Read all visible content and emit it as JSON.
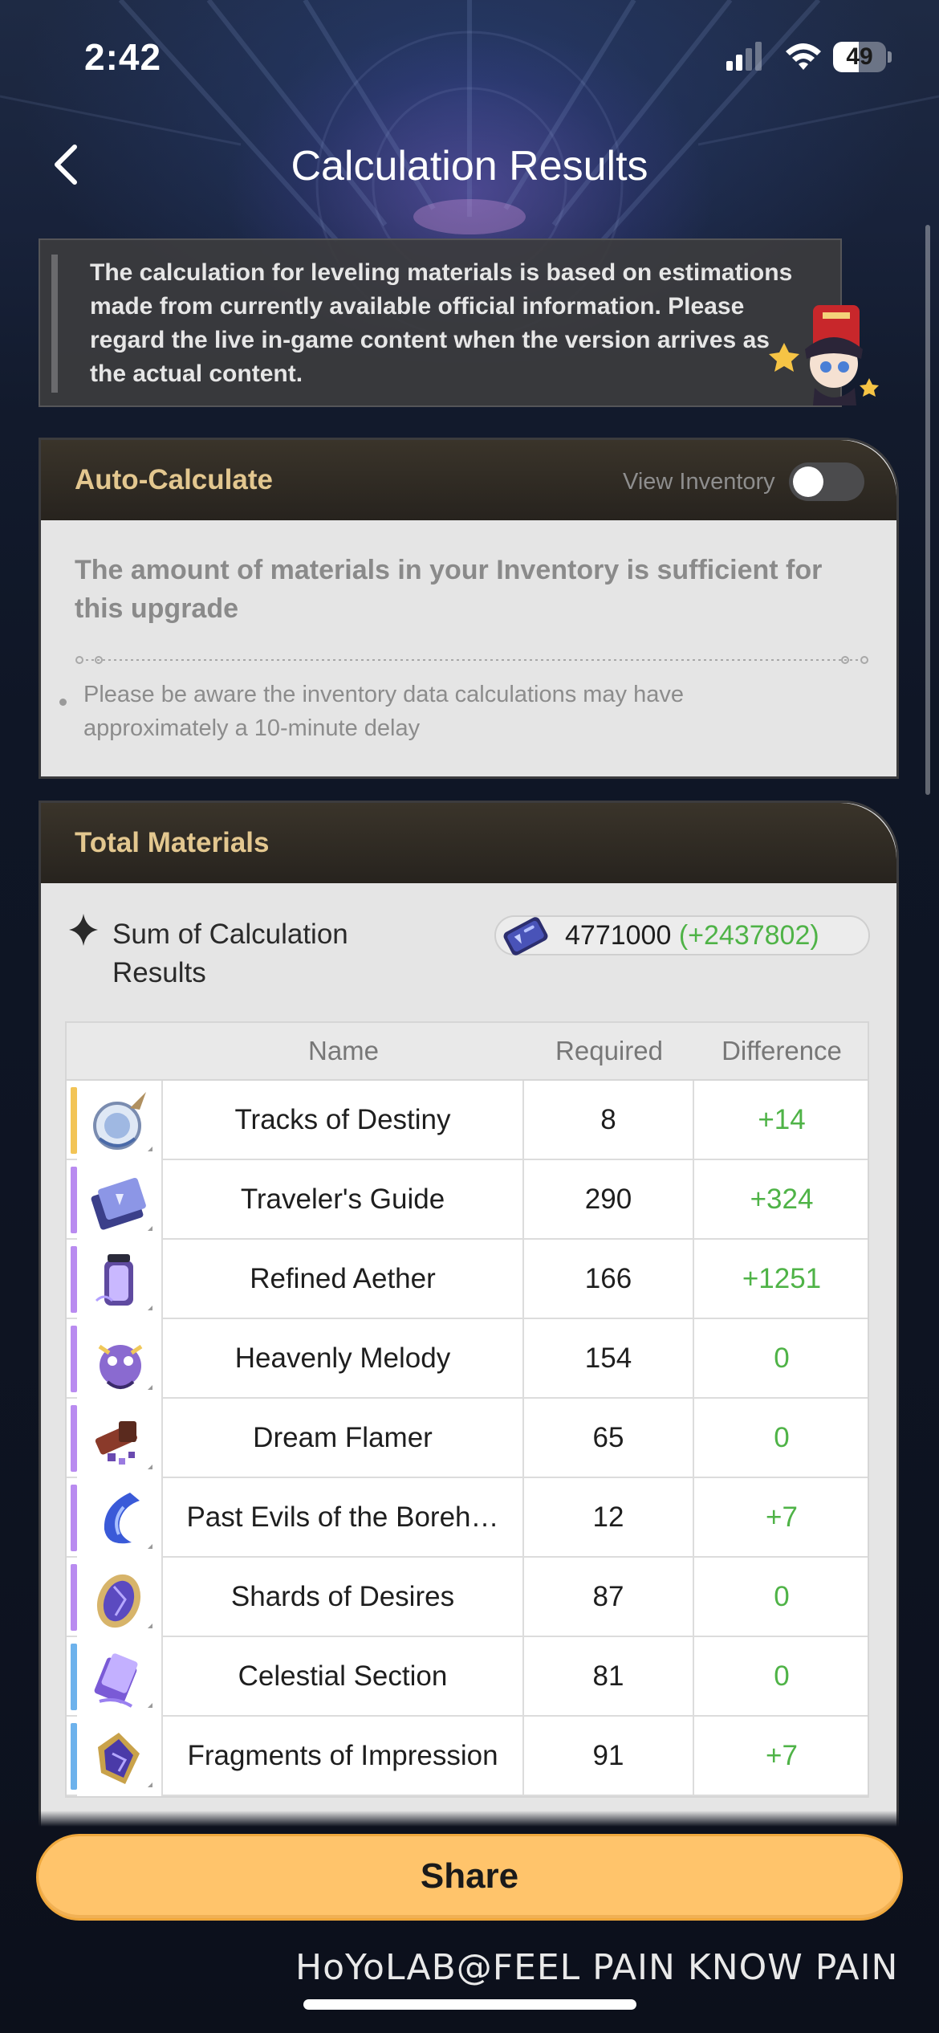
{
  "status_bar": {
    "time": "2:42",
    "battery": "49",
    "battery_level": 0.49
  },
  "header": {
    "title": "Calculation Results"
  },
  "notice": {
    "text": "The calculation for leveling materials is based on estimations made from currently available official information. Please regard the live in-game content when the version arrives as the actual content."
  },
  "auto_calculate": {
    "title": "Auto-Calculate",
    "inventory_toggle_label": "View Inventory",
    "inventory_toggle_on": false,
    "message": "The amount of materials in your Inventory is sufficient for this upgrade",
    "note": "Please be aware the inventory data calculations may have approximately a 10-minute delay"
  },
  "total_materials": {
    "title": "Total Materials",
    "sum_label": "Sum of Calculation Results",
    "sum_value": "4771000",
    "sum_diff": "(+2437802)",
    "columns": {
      "name": "Name",
      "required": "Required",
      "difference": "Difference"
    },
    "rows": [
      {
        "name": "Tracks of Destiny",
        "required": "8",
        "difference": "+14",
        "rarity_color": "#f2c456",
        "icon": "tracks-of-destiny-icon"
      },
      {
        "name": "Traveler's Guide",
        "required": "290",
        "difference": "+324",
        "rarity_color": "#b98bf0",
        "icon": "travelers-guide-icon"
      },
      {
        "name": "Refined Aether",
        "required": "166",
        "difference": "+1251",
        "rarity_color": "#b98bf0",
        "icon": "refined-aether-icon"
      },
      {
        "name": "Heavenly Melody",
        "required": "154",
        "difference": "0",
        "rarity_color": "#b98bf0",
        "icon": "heavenly-melody-icon"
      },
      {
        "name": "Dream Flamer",
        "required": "65",
        "difference": "0",
        "rarity_color": "#b98bf0",
        "icon": "dream-flamer-icon"
      },
      {
        "name": "Past Evils of the Boreh…",
        "required": "12",
        "difference": "+7",
        "rarity_color": "#b98bf0",
        "icon": "past-evils-icon"
      },
      {
        "name": "Shards of Desires",
        "required": "87",
        "difference": "0",
        "rarity_color": "#b98bf0",
        "icon": "shards-of-desires-icon"
      },
      {
        "name": "Celestial Section",
        "required": "81",
        "difference": "0",
        "rarity_color": "#6db2ec",
        "icon": "celestial-section-icon"
      },
      {
        "name": "Fragments of Impression",
        "required": "91",
        "difference": "+7",
        "rarity_color": "#6db2ec",
        "icon": "fragments-of-impression-icon"
      }
    ]
  },
  "share_label": "Share",
  "watermark": "HoYoLAB@FEEL PAIN KNOW PAIN",
  "colors": {
    "positive": "#4fb347",
    "gold_title": "#e3c78f",
    "share_button": "#ffc46b"
  }
}
